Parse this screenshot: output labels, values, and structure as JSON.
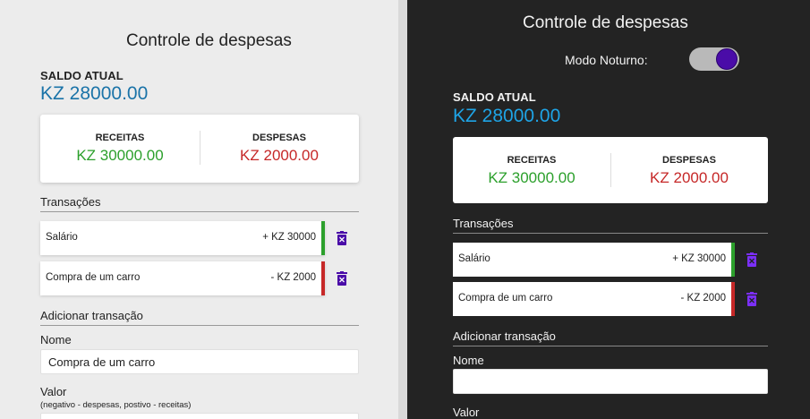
{
  "app": {
    "title": "Controle de despesas",
    "balance_label": "SALDO ATUAL",
    "balance_value": "KZ 28000.00",
    "income_label": "RECEITAS",
    "income_value": "KZ 30000.00",
    "expense_label": "DESPESAS",
    "expense_value": "KZ 2000.00",
    "transactions_title": "Transações",
    "transactions": [
      {
        "name": "Salário",
        "amount": "+ KZ 30000",
        "type": "income"
      },
      {
        "name": "Compra de um carro",
        "amount": "- KZ 2000",
        "type": "expense"
      }
    ],
    "add_title": "Adicionar transação",
    "name_label": "Nome",
    "value_label": "Valor",
    "value_hint": "(negativo - despesas, postivo - receitas)"
  },
  "light": {
    "name_input_value": "Compra de um carro"
  },
  "dark": {
    "night_mode_label": "Modo Noturno:",
    "night_mode_on": true,
    "name_input_value": ""
  },
  "colors": {
    "income": "#2ca02c",
    "expense": "#c62828",
    "balance_light": "#1a73a8",
    "balance_dark": "#1ea4e6",
    "trash": "#4a0ca8",
    "trash_dark": "#7b2ff7",
    "toggle_knob": "#4a0ca8"
  },
  "icons": [
    "trash-icon",
    "moon-icon"
  ]
}
